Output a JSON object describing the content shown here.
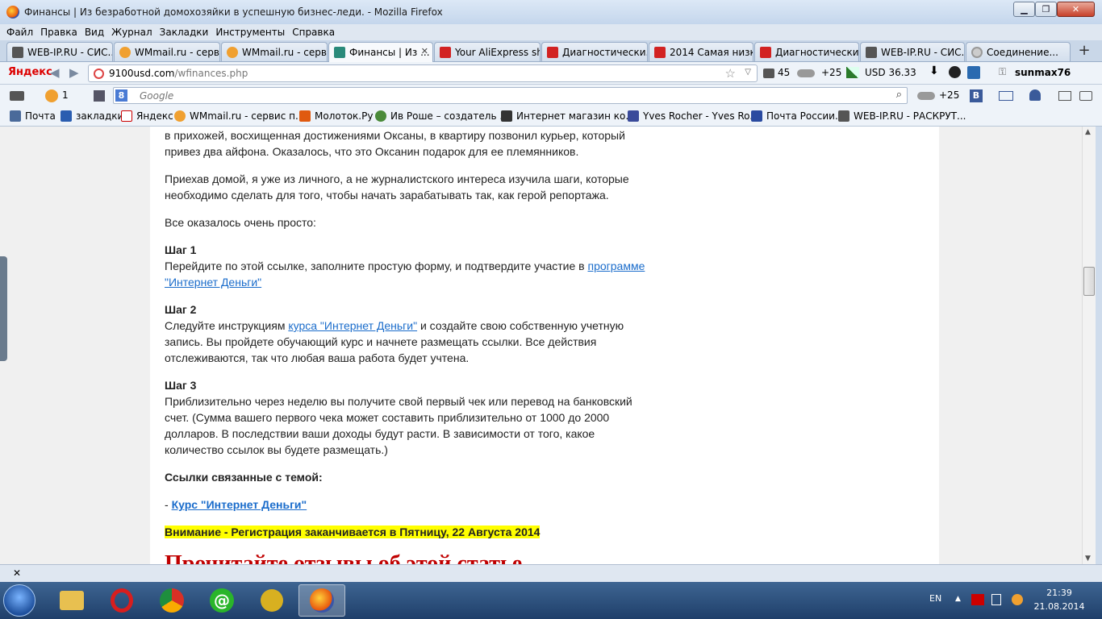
{
  "window": {
    "title": "Финансы | Из безработной домохозяйки в успешную бизнес-леди. - Mozilla Firefox",
    "controls": {
      "minimize": "▁",
      "maximize": "❐",
      "close": "✕"
    }
  },
  "menu": [
    "Файл",
    "Правка",
    "Вид",
    "Журнал",
    "Закладки",
    "Инструменты",
    "Справка"
  ],
  "tabs": [
    {
      "label": "WEB-IP.RU - СИС...",
      "icon_color": "#555555"
    },
    {
      "label": "WMmail.ru - серв...",
      "icon_color": "#f0a030"
    },
    {
      "label": "WMmail.ru - серв...",
      "icon_color": "#f0a030"
    },
    {
      "label": "Финансы | Из ...",
      "icon_color": "#2a8a7a",
      "active": true
    },
    {
      "label": "Your AliExpress sh...",
      "icon_color": "#d22222"
    },
    {
      "label": "Диагностически...",
      "icon_color": "#d22222"
    },
    {
      "label": "2014 Самая низка...",
      "icon_color": "#d22222"
    },
    {
      "label": "Диагностически...",
      "icon_color": "#d22222"
    },
    {
      "label": "WEB-IP.RU - СИС...",
      "icon_color": "#555555"
    },
    {
      "label": "Соединение...",
      "icon_color": "#999999"
    }
  ],
  "tab_close_glyph": "✕",
  "new_tab_glyph": "+",
  "nav": {
    "yandex_logo": "Яндекс",
    "back": "◀",
    "forward": "▶",
    "url_host": "9100usd.com",
    "url_path": "/wfinances.php",
    "star": "☆",
    "dropdown": "▽",
    "mail_count": "45",
    "weather": "+25",
    "usd": "USD 36.33",
    "username": "sunmax76"
  },
  "yabar": {
    "counter": "1",
    "search_placeholder": "Google",
    "weather": "+25",
    "g_label": "8"
  },
  "bookmarks": [
    {
      "label": "Почта",
      "icon_color": "#4a6a9a"
    },
    {
      "label": "закладки",
      "icon_color": "#2a5db0"
    },
    {
      "label": "Яндекс",
      "icon_color": "#cc0000"
    },
    {
      "label": "WMmail.ru - сервис п...",
      "icon_color": "#f0a030"
    },
    {
      "label": "Молоток.Ру",
      "icon_color": "#e05a10"
    },
    {
      "label": "Ив Роше – создатель ...",
      "icon_color": "#4a8a3a"
    },
    {
      "label": "Интернет магазин ко...",
      "icon_color": "#333333"
    },
    {
      "label": "Yves Rocher - Yves Ro...",
      "icon_color": "#3a4a9a"
    },
    {
      "label": "Почта России.",
      "icon_color": "#2a4aa0"
    },
    {
      "label": "WEB-IP.RU - РАСКРУТ...",
      "icon_color": "#555555"
    }
  ],
  "article": {
    "p1": "в прихожей, восхищенная достижениями Оксаны, в квартиру позвонил курьер, который привез два айфона. Оказалось, что это Оксанин подарок для ее племянников.",
    "p2": "Приехав домой, я уже из личного, а не журналистского интереса изучила шаги, которые необходимо сделать для того, чтобы начать зарабатывать так, как герой репортажа.",
    "p3": "Все оказалось очень просто:",
    "step1_title": "Шаг 1",
    "step1_text": "Перейдите по этой ссылке, заполните простую форму, и подтвердите участие в ",
    "step1_link": "программе \"Интернет Деньги\"",
    "step2_title": "Шаг 2",
    "step2_text_a": "Следуйте инструкциям ",
    "step2_link": "курса \"Интернет Деньги\"",
    "step2_text_b": " и создайте свою собственную учетную запись. Вы пройдете обучающий курс и начнете размещать ссылки. Все действия отслеживаются, так что любая ваша работа будет учтена.",
    "step3_title": "Шаг 3",
    "step3_text": "Приблизительно через неделю вы получите свой первый чек или перевод на банковский счет. (Сумма вашего первого чека может составить приблизительно от 1000 до 2000 долларов. В последствии ваши доходы будут расти. В зависимости от того, какое количество ссылок вы будете размещать.)",
    "related_title": "Ссылки связанные с темой:",
    "related_dash": "- ",
    "related_link": "Курс \"Интернет Деньги\"",
    "warning": "Внимание - Регистрация заканчивается в Пятницу, 22 Августа 2014",
    "reviews_heading": "Прочитайте отзывы об этой статье"
  },
  "findbar_close": "✕",
  "taskbar": {
    "lang": "EN",
    "time": "21:39",
    "date": "21.08.2014",
    "apps": [
      {
        "name": "explorer",
        "color": "#e8c050"
      },
      {
        "name": "opera",
        "color": "#d81e1e"
      },
      {
        "name": "chrome",
        "color": "#3a9a3a"
      },
      {
        "name": "mail-agent",
        "color": "#2ab52a"
      },
      {
        "name": "qip",
        "color": "#d8b020"
      },
      {
        "name": "firefox",
        "color": "#e8560c",
        "active": true
      }
    ]
  }
}
